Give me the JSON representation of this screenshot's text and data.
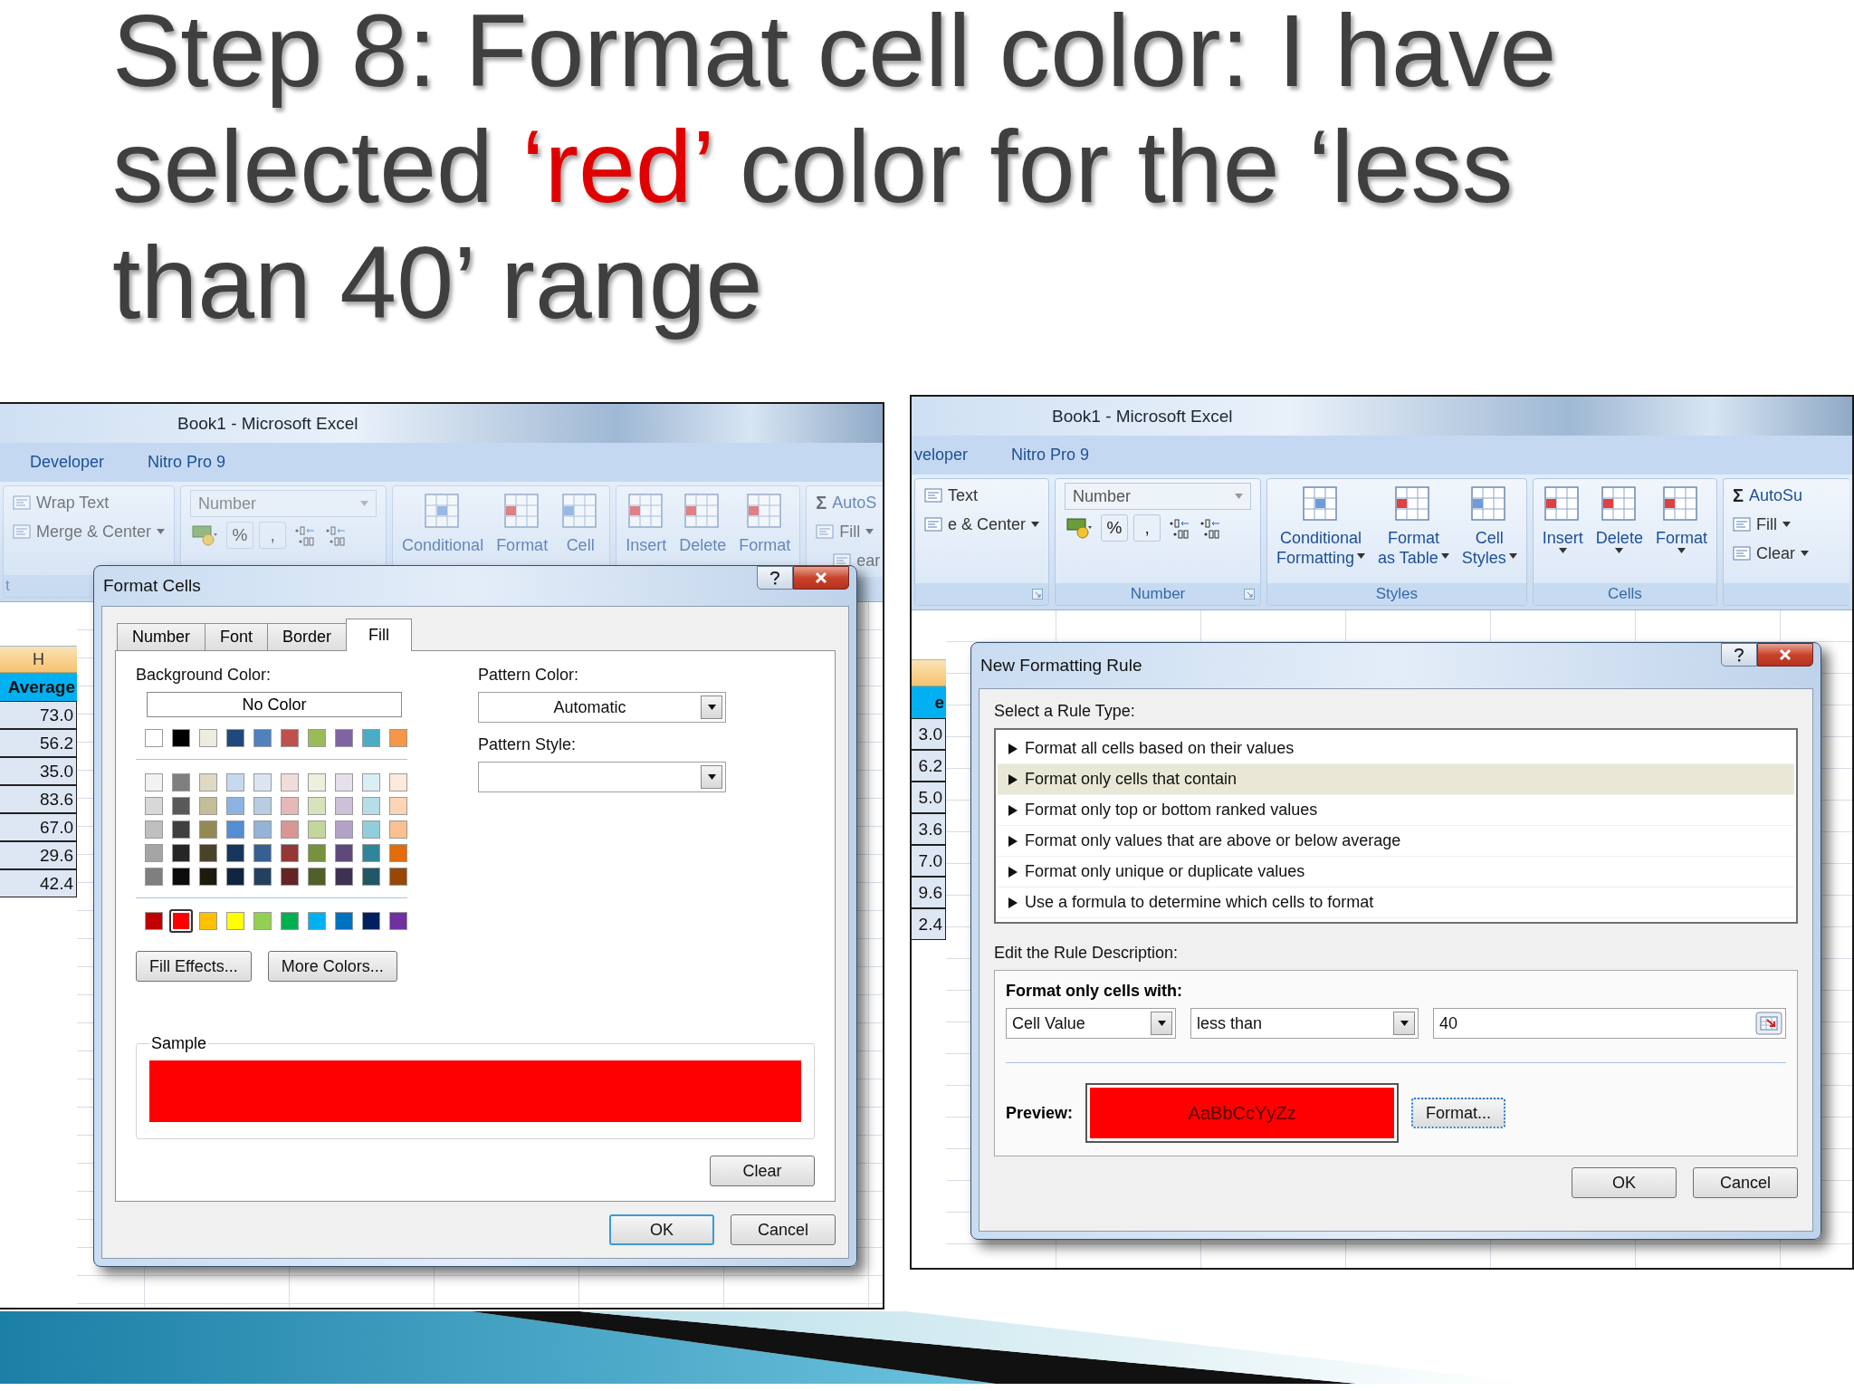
{
  "title": [
    {
      "text": "Step 8: Format cell color: I have selected ",
      "highlight": false
    },
    {
      "text": "‘red’",
      "highlight": true
    },
    {
      "text": " color for the ‘less than 40’ range",
      "highlight": false
    }
  ],
  "windows": [
    {
      "title": "Book1 - Microsoft Excel",
      "active": false,
      "tabs": [
        {
          "label": "Developer"
        },
        {
          "label": "Nitro Pro 9"
        }
      ],
      "ribbon": [
        {
          "label": "t",
          "items": [
            {
              "kind": "small",
              "label": "Wrap Text",
              "menu": false
            },
            {
              "kind": "small",
              "label": "Merge & Center",
              "menu": true
            }
          ]
        },
        {
          "items": [
            {
              "kind": "combo",
              "label": "Number"
            },
            {
              "kind": "numtools",
              "buttons": [
                {
                  "kind": "currency"
                },
                {
                  "kind": "char",
                  "label": "%"
                },
                {
                  "kind": "char",
                  "label": ","
                },
                {
                  "kind": "decimal"
                },
                {
                  "kind": "decimal"
                }
              ]
            }
          ]
        },
        {
          "items": [
            {
              "kind": "large",
              "lines": [
                "Conditional"
              ],
              "menu": false
            },
            {
              "kind": "large",
              "lines": [
                "Format"
              ],
              "menu": false
            },
            {
              "kind": "large",
              "lines": [
                "Cell"
              ],
              "menu": false
            }
          ]
        },
        {
          "items": [
            {
              "kind": "large",
              "lines": [
                "Insert"
              ],
              "menu": false
            },
            {
              "kind": "large",
              "lines": [
                "Delete"
              ],
              "menu": false
            },
            {
              "kind": "large",
              "lines": [
                "Format"
              ],
              "menu": false
            }
          ]
        },
        {
          "items": [
            {
              "kind": "sum",
              "symbol": "Σ",
              "label": "AutoS"
            },
            {
              "kind": "small",
              "label": "Fill",
              "menu": true
            },
            {
              "kind": "small",
              "label": "ear",
              "menu": false
            }
          ]
        }
      ],
      "sheet": {
        "column_header": "H",
        "header_cell": "Average",
        "values": [
          "73.0",
          "56.2",
          "35.0",
          "83.6",
          "67.0",
          "29.6",
          "42.4"
        ]
      },
      "dialog": {
        "kind": "format_cells",
        "title": "Format Cells",
        "tabs": [
          {
            "label": "Number",
            "selected": false
          },
          {
            "label": "Font",
            "selected": false
          },
          {
            "label": "Border",
            "selected": false
          },
          {
            "label": "Fill",
            "selected": true
          }
        ],
        "background_label": "Background Color:",
        "no_color": "No Color",
        "theme_rows": [
          [
            {
              "color": "#ffffff",
              "selected": false
            },
            {
              "color": "#000000",
              "selected": false
            },
            {
              "color": "#eeece1",
              "selected": false
            },
            {
              "color": "#1f497d",
              "selected": false
            },
            {
              "color": "#4f81bd",
              "selected": false
            },
            {
              "color": "#c0504d",
              "selected": false
            },
            {
              "color": "#9bbb59",
              "selected": false
            },
            {
              "color": "#8064a2",
              "selected": false
            },
            {
              "color": "#4bacc6",
              "selected": false
            },
            {
              "color": "#f79646",
              "selected": false
            }
          ],
          [
            {
              "color": "#f2f2f2",
              "selected": false
            },
            {
              "color": "#7f7f7f",
              "selected": false
            },
            {
              "color": "#ddd9c3",
              "selected": false
            },
            {
              "color": "#c6d9f0",
              "selected": false
            },
            {
              "color": "#dbe5f1",
              "selected": false
            },
            {
              "color": "#f2dcdb",
              "selected": false
            },
            {
              "color": "#ebf1dd",
              "selected": false
            },
            {
              "color": "#e5e0ec",
              "selected": false
            },
            {
              "color": "#dbeef3",
              "selected": false
            },
            {
              "color": "#fdeada",
              "selected": false
            }
          ],
          [
            {
              "color": "#d8d8d8",
              "selected": false
            },
            {
              "color": "#595959",
              "selected": false
            },
            {
              "color": "#c4bd97",
              "selected": false
            },
            {
              "color": "#8db3e2",
              "selected": false
            },
            {
              "color": "#b8cce4",
              "selected": false
            },
            {
              "color": "#e5b9b7",
              "selected": false
            },
            {
              "color": "#d7e3bc",
              "selected": false
            },
            {
              "color": "#ccc1d9",
              "selected": false
            },
            {
              "color": "#b7dde8",
              "selected": false
            },
            {
              "color": "#fbd5b5",
              "selected": false
            }
          ],
          [
            {
              "color": "#bfbfbf",
              "selected": false
            },
            {
              "color": "#3f3f3f",
              "selected": false
            },
            {
              "color": "#938953",
              "selected": false
            },
            {
              "color": "#548dd4",
              "selected": false
            },
            {
              "color": "#95b3d7",
              "selected": false
            },
            {
              "color": "#d99694",
              "selected": false
            },
            {
              "color": "#c3d69b",
              "selected": false
            },
            {
              "color": "#b2a2c7",
              "selected": false
            },
            {
              "color": "#92cddc",
              "selected": false
            },
            {
              "color": "#fac08f",
              "selected": false
            }
          ],
          [
            {
              "color": "#a5a5a5",
              "selected": false
            },
            {
              "color": "#262626",
              "selected": false
            },
            {
              "color": "#494429",
              "selected": false
            },
            {
              "color": "#17365d",
              "selected": false
            },
            {
              "color": "#366092",
              "selected": false
            },
            {
              "color": "#953734",
              "selected": false
            },
            {
              "color": "#76923c",
              "selected": false
            },
            {
              "color": "#5f497a",
              "selected": false
            },
            {
              "color": "#31859b",
              "selected": false
            },
            {
              "color": "#e36c09",
              "selected": false
            }
          ],
          [
            {
              "color": "#7f7f7f",
              "selected": false
            },
            {
              "color": "#0c0c0c",
              "selected": false
            },
            {
              "color": "#1d1b10",
              "selected": false
            },
            {
              "color": "#0f243e",
              "selected": false
            },
            {
              "color": "#244061",
              "selected": false
            },
            {
              "color": "#632423",
              "selected": false
            },
            {
              "color": "#4f6128",
              "selected": false
            },
            {
              "color": "#3f3151",
              "selected": false
            },
            {
              "color": "#205867",
              "selected": false
            },
            {
              "color": "#974806",
              "selected": false
            }
          ]
        ],
        "standard_row": [
          {
            "color": "#c00000",
            "selected": false
          },
          {
            "color": "#ff0000",
            "selected": true
          },
          {
            "color": "#ffc000",
            "selected": false
          },
          {
            "color": "#ffff00",
            "selected": false
          },
          {
            "color": "#92d050",
            "selected": false
          },
          {
            "color": "#00b050",
            "selected": false
          },
          {
            "color": "#00b0f0",
            "selected": false
          },
          {
            "color": "#0070c0",
            "selected": false
          },
          {
            "color": "#002060",
            "selected": false
          },
          {
            "color": "#7030a0",
            "selected": false
          }
        ],
        "buttons": [
          "Fill Effects...",
          "More Colors..."
        ],
        "pattern_color": {
          "label": "Pattern Color:",
          "value": "Automatic"
        },
        "pattern_style": {
          "label": "Pattern Style:"
        },
        "sample": {
          "label": "Sample",
          "color": "#ff0000"
        },
        "clear": "Clear",
        "ok": "OK",
        "cancel": "Cancel"
      }
    },
    {
      "title": "Book1 - Microsoft Excel",
      "active": true,
      "tabs": [
        {
          "label": "veloper"
        },
        {
          "label": "Nitro Pro 9"
        }
      ],
      "ribbon": [
        {
          "launcher": true,
          "items": [
            {
              "kind": "small",
              "label": "Text",
              "menu": false
            },
            {
              "kind": "small",
              "label": "e & Center",
              "menu": true
            }
          ]
        },
        {
          "label": "Number",
          "launcher": true,
          "items": [
            {
              "kind": "combo",
              "label": "Number"
            },
            {
              "kind": "numtools",
              "buttons": [
                {
                  "kind": "currency"
                },
                {
                  "kind": "char",
                  "label": "%"
                },
                {
                  "kind": "char",
                  "label": ","
                },
                {
                  "kind": "decimal"
                },
                {
                  "kind": "decimal"
                }
              ]
            }
          ]
        },
        {
          "label": "Styles",
          "items": [
            {
              "kind": "large",
              "lines": [
                "Conditional",
                "Formatting"
              ],
              "menu": true
            },
            {
              "kind": "large",
              "lines": [
                "Format",
                "as Table"
              ],
              "menu": true
            },
            {
              "kind": "large",
              "lines": [
                "Cell",
                "Styles"
              ],
              "menu": true
            }
          ]
        },
        {
          "label": "Cells",
          "items": [
            {
              "kind": "large",
              "lines": [
                "Insert"
              ],
              "menu": true
            },
            {
              "kind": "large",
              "lines": [
                "Delete"
              ],
              "menu": true
            },
            {
              "kind": "large",
              "lines": [
                "Format"
              ],
              "menu": true
            }
          ]
        },
        {
          "items": [
            {
              "kind": "sum",
              "symbol": "Σ",
              "label": "AutoSu"
            },
            {
              "kind": "small",
              "label": "Fill",
              "menu": true
            },
            {
              "kind": "small",
              "label": "Clear",
              "menu": true
            }
          ]
        }
      ],
      "sheet": {
        "header_cell": "e",
        "values": [
          "3.0",
          "6.2",
          "5.0",
          "3.6",
          "7.0",
          "9.6",
          "2.4"
        ]
      },
      "dialog": {
        "kind": "rule",
        "title": "New Formatting Rule",
        "type_label": "Select a Rule Type:",
        "rule_types": [
          {
            "label": "Format all cells based on their values",
            "selected": false
          },
          {
            "label": "Format only cells that contain",
            "selected": true
          },
          {
            "label": "Format only top or bottom ranked values",
            "selected": false
          },
          {
            "label": "Format only values that are above or below average",
            "selected": false
          },
          {
            "label": "Format only unique or duplicate values",
            "selected": false
          },
          {
            "label": "Use a formula to determine which cells to format",
            "selected": false
          }
        ],
        "description_label": "Edit the Rule Description:",
        "condition_heading": "Format only cells with:",
        "conditions": [
          {
            "kind": "combo",
            "value": "Cell Value"
          },
          {
            "kind": "combo",
            "value": "less than"
          },
          {
            "kind": "reference",
            "value": "40"
          }
        ],
        "preview": {
          "label": "Preview:",
          "text": "AaBbCcYyZz",
          "color": "#ff0000"
        },
        "format_button": "Format...",
        "ok": "OK",
        "cancel": "Cancel"
      }
    }
  ]
}
